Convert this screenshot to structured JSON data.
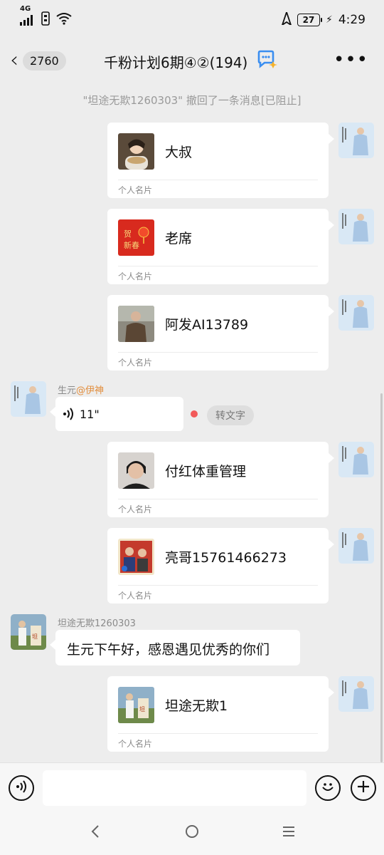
{
  "status_bar": {
    "network": "4G",
    "battery": "27",
    "time": "4:29"
  },
  "header": {
    "unread_count": "2760",
    "title": "千粉计划6期④②(194)"
  },
  "system_message": "\"坦途无欺1260303\" 撤回了一条消息[已阻止]",
  "card_label": "个人名片",
  "cards": [
    {
      "name": "大叔"
    },
    {
      "name": "老席"
    },
    {
      "name": "阿发AI13789"
    },
    {
      "name": "付红体重管理"
    },
    {
      "name": "亮哥15761466273"
    },
    {
      "name": "坦途无欺1"
    }
  ],
  "voice_message": {
    "sender": "生元",
    "mention": "@伊神",
    "duration": "11\"",
    "convert_label": "转文字"
  },
  "text_message": {
    "sender": "坦途无欺1260303",
    "text": "生元下午好，感恩遇见优秀的你们"
  },
  "colors": {
    "background": "#ededed",
    "bubble": "#ffffff",
    "mention": "#e28d3c",
    "unread_dot": "#f25a5a"
  }
}
